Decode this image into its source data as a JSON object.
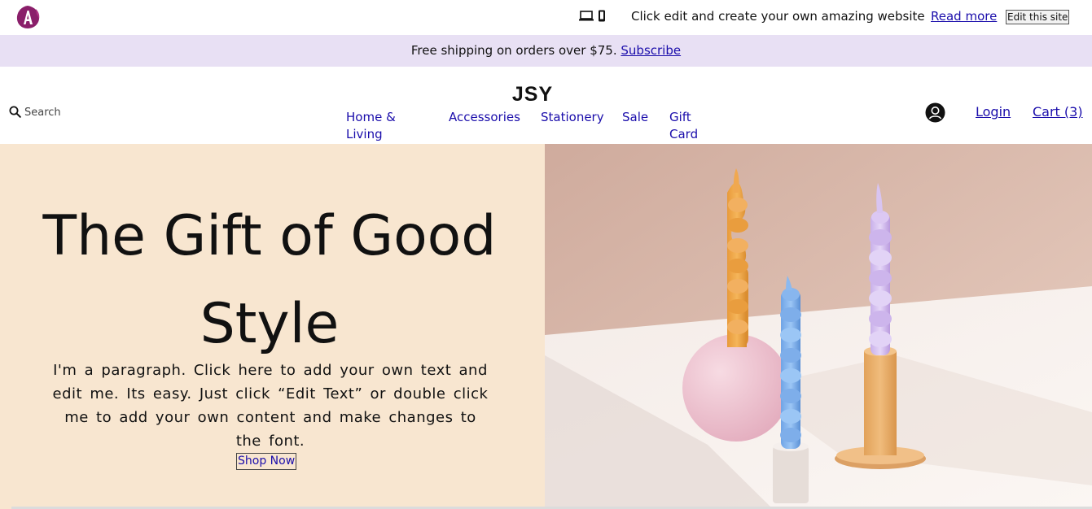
{
  "topbar": {
    "logo_icon": "app-logo-icon",
    "device_icons": [
      "laptop-icon",
      "mobile-icon"
    ],
    "promo_text": "Click edit and create your own amazing website",
    "read_more": "Read more",
    "edit_button": "Edit this site"
  },
  "shipping_banner": {
    "text": "Free shipping on orders over $75.",
    "link": "Subscribe"
  },
  "header": {
    "search_placeholder": "Search",
    "brand": "JSY",
    "nav": {
      "home_living": "Home & Living",
      "accessories": "Accessories",
      "stationery": "Stationery",
      "sale": "Sale",
      "gift_card": "Gift Card"
    },
    "account_icon": "user-avatar-icon",
    "login": "Login",
    "cart": "Cart (3)"
  },
  "hero": {
    "title": "The Gift of Good Style",
    "paragraph": "I'm a paragraph. Click here to add your own text and edit me. Its easy. Just click “Edit Text” or double click me to add your own content and make changes to the font.",
    "button": "Shop Now",
    "image": "twisted-candles-image"
  },
  "colors": {
    "banner_bg": "#e8e0f4",
    "hero_bg": "#f8e6d0",
    "link": "#1a0dab"
  }
}
